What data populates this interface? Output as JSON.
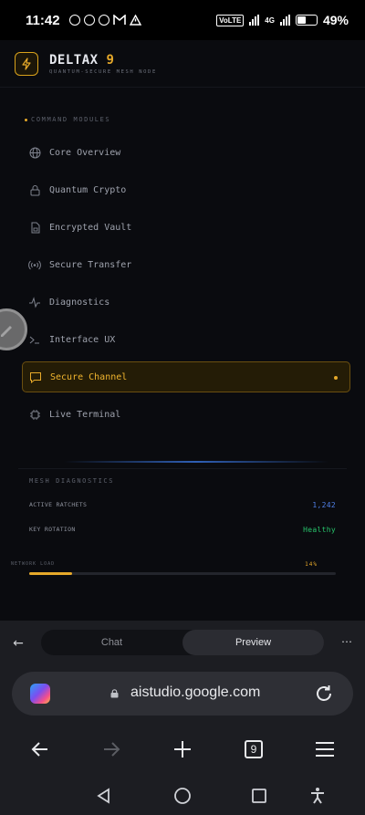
{
  "status_bar": {
    "time": "11:42",
    "notification_icons": [
      "hotspot-icon",
      "messenger-icon",
      "whatsapp-icon",
      "gmail-icon",
      "warning-icon"
    ],
    "volte": "VoLTE",
    "network": "4G",
    "battery": "49%"
  },
  "app": {
    "brand_name": "DELTAX",
    "brand_number": "9",
    "subtitle": "QUANTUM-SECURE MESH NODE",
    "section_label": "COMMAND MODULES",
    "nav": [
      {
        "label": "Core Overview",
        "icon": "globe-icon"
      },
      {
        "label": "Quantum Crypto",
        "icon": "lock-icon"
      },
      {
        "label": "Encrypted Vault",
        "icon": "file-icon"
      },
      {
        "label": "Secure Transfer",
        "icon": "broadcast-icon"
      },
      {
        "label": "Diagnostics",
        "icon": "pulse-icon"
      },
      {
        "label": "Interface UX",
        "icon": "terminal-prompt-icon"
      },
      {
        "label": "Secure Channel",
        "icon": "chat-icon",
        "active": true
      },
      {
        "label": "Live Terminal",
        "icon": "chip-icon"
      }
    ],
    "diagnostics": {
      "title": "MESH DIAGNOSTICS",
      "active_ratchets_label": "ACTIVE RATCHETS",
      "active_ratchets_value": "1,242",
      "key_rotation_label": "KEY ROTATION",
      "key_rotation_value": "Healthy",
      "network_load_label": "NETWORK LOAD",
      "network_load_value": "14%",
      "network_load_fraction": 0.14
    },
    "accent_color": "#e6a92a"
  },
  "studio_bar": {
    "tabs": [
      "Chat",
      "Preview"
    ],
    "selected_tab": "Preview"
  },
  "browser": {
    "url": "aistudio.google.com",
    "tab_count": "9"
  }
}
